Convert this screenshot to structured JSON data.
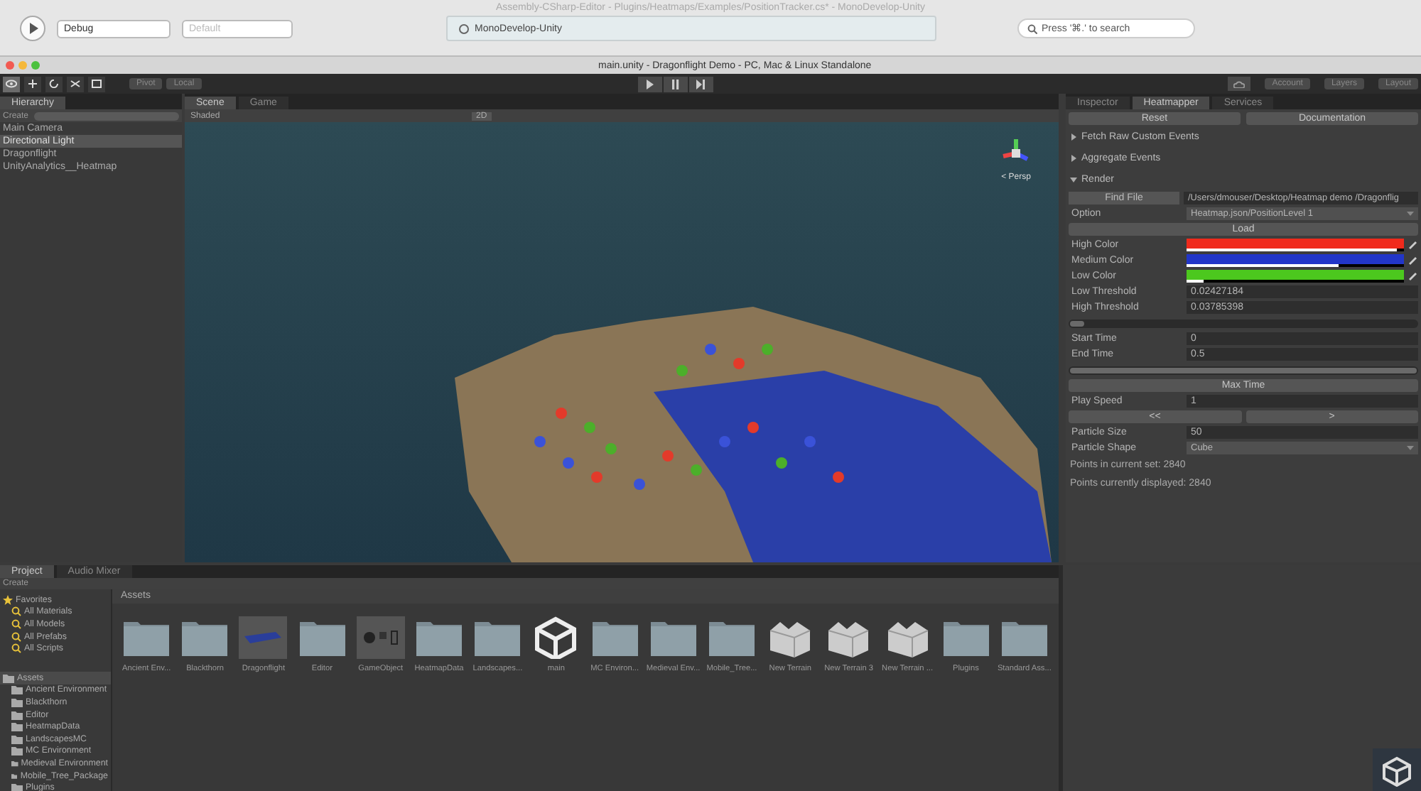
{
  "mono_window": {
    "title": "Assembly-CSharp-Editor - Plugins/Heatmaps/Examples/PositionTracker.cs* - MonoDevelop-Unity",
    "config": "Debug",
    "platform": "Default",
    "status": "MonoDevelop-Unity",
    "search_placeholder": "Press '⌘.' to search"
  },
  "unity_window": {
    "title": "main.unity - Dragonflight Demo - PC, Mac & Linux Standalone"
  },
  "toolbar": {
    "tools": [
      {
        "kind": "view",
        "selected": true
      },
      {
        "kind": "move",
        "selected": false
      },
      {
        "kind": "rotate",
        "selected": false
      },
      {
        "kind": "scale",
        "selected": false
      },
      {
        "kind": "rect",
        "selected": false
      }
    ],
    "pivot": "Pivot",
    "space": "Local",
    "account": "Account",
    "layers": "Layers",
    "layout": "Layout"
  },
  "hierarchy": {
    "tab": "Hierarchy",
    "create": "Create",
    "items": [
      {
        "label": "Main Camera",
        "selected": false
      },
      {
        "label": "Directional Light",
        "selected": true
      },
      {
        "label": "Dragonflight",
        "selected": false
      },
      {
        "label": "UnityAnalytics__Heatmap",
        "selected": false
      }
    ]
  },
  "scene": {
    "tabs": [
      {
        "label": "Scene",
        "selected": true
      },
      {
        "label": "Game",
        "selected": false
      }
    ],
    "shading": "Shaded",
    "mode_2d": "2D",
    "gizmo_label": "< Persp"
  },
  "inspector": {
    "tabs": [
      {
        "label": "Inspector",
        "selected": false
      },
      {
        "label": "Heatmapper",
        "selected": true
      },
      {
        "label": "Services",
        "selected": false
      }
    ],
    "buttons": [
      "Reset",
      "Documentation"
    ],
    "sections": [
      {
        "label": "Fetch Raw Custom Events",
        "expanded": false
      },
      {
        "label": "Aggregate Events",
        "expanded": false
      },
      {
        "label": "Render",
        "expanded": true,
        "rows": [
          {
            "kind": "file",
            "button": "Find File",
            "value": "/Users/dmouser/Desktop/Heatmap demo /Dragonflig"
          },
          {
            "kind": "dropdown",
            "label": "Option",
            "value": "Heatmap.json/PositionLevel 1"
          },
          {
            "kind": "button",
            "label": "Load"
          },
          {
            "kind": "color",
            "label": "High Color",
            "color": "#f02a1c",
            "level": 0.97
          },
          {
            "kind": "color",
            "label": "Medium Color",
            "color": "#2236c8",
            "level": 0.7
          },
          {
            "kind": "color",
            "label": "Low Color",
            "color": "#4cc81e",
            "level": 0.08
          },
          {
            "kind": "field",
            "label": "Low Threshold",
            "value": "0.02427184"
          },
          {
            "kind": "field",
            "label": "High Threshold",
            "value": "0.03785398"
          },
          {
            "kind": "slider",
            "level": 0.04
          },
          {
            "kind": "field",
            "label": "Start Time",
            "value": "0"
          },
          {
            "kind": "field",
            "label": "End Time",
            "value": "0.5"
          },
          {
            "kind": "slider",
            "level": 1
          },
          {
            "kind": "button",
            "label": "Max Time"
          },
          {
            "kind": "field",
            "label": "Play Speed",
            "value": "1"
          },
          {
            "kind": "pair",
            "labels": [
              "<<",
              ">"
            ]
          },
          {
            "kind": "field",
            "label": "Particle Size",
            "value": "50"
          },
          {
            "kind": "dropdown",
            "label": "Particle Shape",
            "value": "Cube"
          },
          {
            "kind": "note",
            "label": "Points in current set: 2840"
          },
          {
            "kind": "note",
            "label": "Points currently displayed: 2840"
          }
        ]
      }
    ]
  },
  "project": {
    "tabs": [
      {
        "label": "Project",
        "selected": true
      },
      {
        "label": "Audio Mixer",
        "selected": false
      }
    ],
    "create": "Create",
    "favorites": {
      "label": "Favorites",
      "selected": false,
      "items": [
        "All Materials",
        "All Models",
        "All Prefabs",
        "All Scripts"
      ]
    },
    "assets": {
      "label": "Assets",
      "selected": true,
      "items": [
        "Ancient Environment",
        "Blackthorn",
        "Editor",
        "HeatmapData",
        "LandscapesMC",
        "MC Environment",
        "Medieval Environment",
        "Mobile_Tree_Package",
        "Plugins"
      ]
    },
    "breadcrumb": "Assets",
    "grid": [
      {
        "label": "Ancient Env...",
        "kind": "folder"
      },
      {
        "label": "Blackthorn",
        "kind": "folder"
      },
      {
        "label": "Dragonflight",
        "kind": "prefab"
      },
      {
        "label": "Editor",
        "kind": "folder"
      },
      {
        "label": "GameObject",
        "kind": "objects"
      },
      {
        "label": "HeatmapData",
        "kind": "folder"
      },
      {
        "label": "Landscapes...",
        "kind": "folder"
      },
      {
        "label": "main",
        "kind": "unity"
      },
      {
        "label": "MC Environ...",
        "kind": "folder"
      },
      {
        "label": "Medieval Env...",
        "kind": "folder"
      },
      {
        "label": "Mobile_Tree...",
        "kind": "folder"
      },
      {
        "label": "New Terrain",
        "kind": "terrain"
      },
      {
        "label": "New Terrain 3",
        "kind": "terrain"
      },
      {
        "label": "New Terrain ...",
        "kind": "terrain"
      },
      {
        "label": "Plugins",
        "kind": "folder"
      },
      {
        "label": "Standard Ass...",
        "kind": "folder"
      }
    ]
  }
}
